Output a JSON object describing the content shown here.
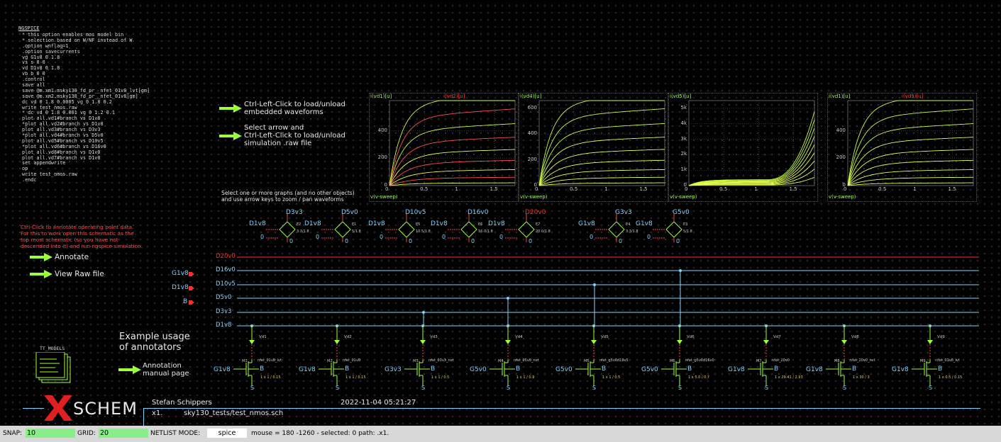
{
  "netlist": {
    "title": "NGSPICE",
    "lines": [
      "* this option enables mos model bin",
      "* selection based on W/NF instead of W",
      ".option wnflag=1",
      ".option savecurrents",
      "vg G1v8 0 1.8",
      "vs s 0 0",
      "vd D1v8 0 1.8",
      "vb b 0 0",
      ".control",
      "save all",
      "save @m.xm1.msky130_fd_pr__nfet_01v8_lvt[gm]",
      "save @m.xm2.msky130_fd_pr__nfet_01v8[gm]",
      "dc vd 0 1.8 0.0005 vg 0 1.8 0.2",
      "write test_nmos.raw",
      "* dc vd 0 1.8 0.001 vg 0 1.2 0.1",
      "plot all.vd1#branch vs D1v8",
      "*plot all.vd2#branch vs D1v8",
      "plot all.vd3#branch vs D3v3",
      "*plot all.vd4#branch vs D5v0",
      "plot all.vd5#branch vs D10v5",
      "*plot all.vd6#branch vs D16v0",
      "plot all.vd8#branch vs D1v8",
      "plot all.vd7#branch vs D1v8",
      "set appendwrite",
      "op",
      "write test_nmos.raw",
      ".endc"
    ]
  },
  "hints": {
    "embedded": "Ctrl-Left-Click to load/unload\nembedded waveforms",
    "select_arrow": "Select arrow and\nCtrl-Left-Click to load/unload\nsimulation .raw file",
    "zoom": "Select one or more graphs (and no other objects)\nand use arrow keys to zoom / pan waveforms",
    "operating_point": "Ctrl-Click to annotate operating point data.\nFor this to work open this schematic as the\ntop most schematic (so you have not\ndescended into it) and run ngspice simulation.",
    "example_usage": "Example usage\nof annotators",
    "annotation_manual": "Annotation\nmanual page"
  },
  "buttons": {
    "annotate": "Annotate",
    "view_raw": "View Raw file"
  },
  "graphs": [
    {
      "ylabel": "i(vd1)[u]",
      "ylabel2": "i(vd2)[u]",
      "xlabel": "v(v-sweep)",
      "yticks": [
        "0",
        "200",
        "400"
      ],
      "xticks": [
        "0",
        "0.5",
        "1",
        "1.5"
      ],
      "ymax": 620
    },
    {
      "ylabel": "i(vd4)[u]",
      "ylabel2": "",
      "xlabel": "v(v-sweep)",
      "yticks": [
        "0",
        "200",
        "400",
        "600"
      ],
      "xticks": [
        "0",
        "0.5",
        "1",
        "1.5"
      ],
      "ymax": 660
    },
    {
      "ylabel": "i(vd5)[u]",
      "ylabel2": "",
      "xlabel": "v(v-sweep)",
      "yticks": [
        "0",
        "1k",
        "2k",
        "3k",
        "4k",
        "5k"
      ],
      "xticks": [
        "0",
        "0.5",
        "1",
        "1.5"
      ],
      "ymax": 5500
    },
    {
      "ylabel": "i(vd1)[u]",
      "ylabel2": "i(vd9)[u]",
      "xlabel": "v(v-sweep)",
      "yticks": [
        "0",
        "200",
        "400"
      ],
      "xticks": [
        "0",
        "0.5",
        "1",
        "1.5"
      ],
      "ymax": 620
    }
  ],
  "sources": [
    {
      "name": "D3v3",
      "in": "D1v8",
      "val": "3.3/1.8",
      "ref": "E2"
    },
    {
      "name": "D5v0",
      "in": "D1v8",
      "val": "5/1.8",
      "ref": "E1"
    },
    {
      "name": "D10v5",
      "in": "D1v8",
      "val": "10.5/1.8",
      "ref": "E5"
    },
    {
      "name": "D16v0",
      "in": "D1v8",
      "val": "16.0/1.8",
      "ref": "E6"
    },
    {
      "name": "D20v0",
      "in": "D1v8",
      "val": "20.0/1.8",
      "ref": "E7",
      "red": true
    },
    {
      "name": "G3v3",
      "in": "G1v8",
      "val": "3.3/1.8",
      "ref": "E4"
    },
    {
      "name": "G5v0",
      "in": "G1v8",
      "val": "5/1.8",
      "ref": "E3"
    }
  ],
  "buses": [
    "D20v0",
    "D16v0",
    "D10v5",
    "D5v0",
    "D3v3",
    "D1v8"
  ],
  "pins": [
    "G1v8",
    "D1v8",
    "B"
  ],
  "transistors": [
    {
      "gate": "G1v8",
      "vname": "Vd1",
      "model": "nfet_01v8_lvt",
      "size": "1 x 1 / 0.15"
    },
    {
      "gate": "G1v8",
      "vname": "Vd2",
      "model": "nfet_01v8",
      "size": "1 x 1 / 0.15"
    },
    {
      "gate": "G3v3",
      "vname": "Vd3",
      "model": "nfet_03v3_nvt",
      "size": "1 x 1 / 0.5"
    },
    {
      "gate": "G5v0",
      "vname": "Vd4",
      "model": "nfet_05v0_nvt",
      "size": "1 x 1 / 0.9"
    },
    {
      "gate": "G5v0",
      "vname": "Vd5",
      "model": "nfet_g5v0d10v5",
      "size": "1 x 1 / 0.5"
    },
    {
      "gate": "G5v0",
      "vname": "Vd6",
      "model": "nfet_g5v0d16v0",
      "size": "1 x 5.0 / 0.7"
    },
    {
      "gate": "G1v8",
      "vname": "Vd7",
      "model": "nfet_20v0",
      "size": "1 x 29.41 / 2.93"
    },
    {
      "gate": "G1v8",
      "vname": "Vd8",
      "model": "nfet_20v0_nvt",
      "size": "1 x 30 / 3"
    },
    {
      "gate": "G1v8",
      "vname": "Vd9",
      "model": "nfet_01v8_lvt",
      "size": "1 x 0.5 / 0.15"
    }
  ],
  "titleblock": {
    "logo": "SCHEM",
    "author": "Stefan Schippers",
    "date": "2022-11-04  05:21:27",
    "instance": "x1.",
    "path": "sky130_tests/test_nmos.sch",
    "models": "TT_MODELS"
  },
  "status": {
    "snap_label": "SNAP:",
    "snap": "10",
    "grid_label": "GRID:",
    "grid": "20",
    "netlist_label": "NETLIST MODE:",
    "netlist_mode": "spice",
    "info": "mouse = 180 -1260 - selected: 0 path: .x1."
  },
  "colors": {
    "cyan": "#7fd4ff",
    "green": "#9bff3a",
    "red": "#ff3030",
    "yellow": "#e8ff40"
  }
}
